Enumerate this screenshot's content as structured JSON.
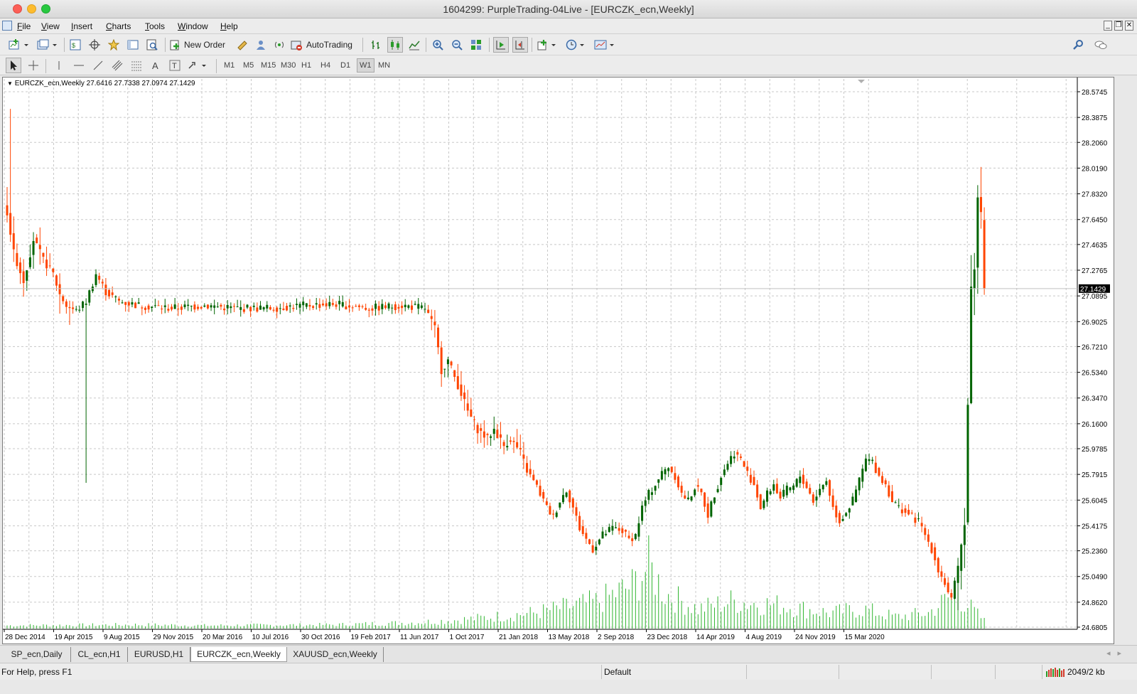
{
  "window": {
    "title": "1604299: PurpleTrading-04Live - [EURCZK_ecn,Weekly]"
  },
  "menu": [
    "File",
    "View",
    "Insert",
    "Charts",
    "Tools",
    "Window",
    "Help"
  ],
  "toolbar": {
    "new_order": "New Order",
    "auto_trading": "AutoTrading"
  },
  "timeframes": [
    "M1",
    "M5",
    "M15",
    "M30",
    "H1",
    "H4",
    "D1",
    "W1",
    "MN"
  ],
  "active_timeframe": "W1",
  "chart": {
    "legend": "EURCZK_ecn,Weekly  27.6416 27.7338 27.0974 27.1429",
    "current_price": "27.1429"
  },
  "chart_data": {
    "type": "candlestick",
    "symbol": "EURCZK_ecn",
    "period": "Weekly",
    "ohlc_last": {
      "open": 27.6416,
      "high": 27.7338,
      "low": 27.0974,
      "close": 27.1429
    },
    "y_ticks": [
      "28.5745",
      "28.3875",
      "28.2060",
      "28.0190",
      "27.8320",
      "27.6450",
      "27.4635",
      "27.2765",
      "27.0895",
      "26.9025",
      "26.7210",
      "26.5340",
      "26.3470",
      "26.1600",
      "25.9785",
      "25.7915",
      "25.6045",
      "25.4175",
      "25.2360",
      "25.0490",
      "24.8620",
      "24.6805"
    ],
    "ylim": [
      24.6805,
      28.5745
    ],
    "x_ticks": [
      "28 Dec 2014",
      "19 Apr 2015",
      "9 Aug 2015",
      "29 Nov 2015",
      "20 Mar 2016",
      "10 Jul 2016",
      "30 Oct 2016",
      "19 Feb 2017",
      "11 Jun 2017",
      "1 Oct 2017",
      "21 Jan 2018",
      "13 May 2018",
      "2 Sep 2018",
      "23 Dec 2018",
      "14 Apr 2019",
      "4 Aug 2019",
      "24 Nov 2019",
      "15 Mar 2020"
    ],
    "colors": {
      "bull": "#006400",
      "bear": "#ff4500",
      "grid": "#c8c8c8",
      "volume": "#2fb52f",
      "price_line": "#c0c0c0"
    },
    "grid": true,
    "close_path": [
      [
        0,
        27.7
      ],
      [
        2,
        27.4
      ],
      [
        5,
        27.2
      ],
      [
        8,
        27.5
      ],
      [
        11,
        27.35
      ],
      [
        14,
        27.25
      ],
      [
        16,
        27.1
      ],
      [
        18,
        27.02
      ],
      [
        21,
        26.98
      ],
      [
        24,
        27.05
      ],
      [
        27,
        27.25
      ],
      [
        30,
        27.12
      ],
      [
        34,
        27.05
      ],
      [
        40,
        27.02
      ],
      [
        50,
        27.0
      ],
      [
        60,
        27.02
      ],
      [
        70,
        27.0
      ],
      [
        80,
        27.0
      ],
      [
        90,
        27.02
      ],
      [
        100,
        27.03
      ],
      [
        110,
        27.0
      ],
      [
        120,
        27.02
      ],
      [
        127,
        27.0
      ],
      [
        130,
        26.85
      ],
      [
        132,
        26.55
      ],
      [
        134,
        26.62
      ],
      [
        136,
        26.5
      ],
      [
        138,
        26.38
      ],
      [
        140,
        26.25
      ],
      [
        143,
        26.12
      ],
      [
        146,
        26.05
      ],
      [
        148,
        26.12
      ],
      [
        151,
        26.0
      ],
      [
        153,
        26.05
      ],
      [
        156,
        25.95
      ],
      [
        158,
        25.82
      ],
      [
        161,
        25.7
      ],
      [
        164,
        25.55
      ],
      [
        166,
        25.48
      ],
      [
        168,
        25.6
      ],
      [
        170,
        25.68
      ],
      [
        172,
        25.55
      ],
      [
        174,
        25.4
      ],
      [
        176,
        25.32
      ],
      [
        178,
        25.25
      ],
      [
        181,
        25.35
      ],
      [
        184,
        25.4
      ],
      [
        187,
        25.38
      ],
      [
        189,
        25.32
      ],
      [
        191,
        25.35
      ],
      [
        193,
        25.55
      ],
      [
        195,
        25.65
      ],
      [
        197,
        25.72
      ],
      [
        199,
        25.8
      ],
      [
        201,
        25.85
      ],
      [
        203,
        25.78
      ],
      [
        205,
        25.65
      ],
      [
        207,
        25.6
      ],
      [
        209,
        25.7
      ],
      [
        211,
        25.65
      ],
      [
        213,
        25.5
      ],
      [
        215,
        25.65
      ],
      [
        217,
        25.78
      ],
      [
        219,
        25.88
      ],
      [
        221,
        25.95
      ],
      [
        223,
        25.9
      ],
      [
        225,
        25.8
      ],
      [
        227,
        25.72
      ],
      [
        229,
        25.55
      ],
      [
        231,
        25.65
      ],
      [
        233,
        25.72
      ],
      [
        235,
        25.62
      ],
      [
        237,
        25.68
      ],
      [
        239,
        25.7
      ],
      [
        241,
        25.78
      ],
      [
        243,
        25.7
      ],
      [
        245,
        25.6
      ],
      [
        247,
        25.68
      ],
      [
        249,
        25.75
      ],
      [
        251,
        25.55
      ],
      [
        253,
        25.45
      ],
      [
        255,
        25.52
      ],
      [
        257,
        25.6
      ],
      [
        259,
        25.75
      ],
      [
        261,
        25.9
      ],
      [
        263,
        25.88
      ],
      [
        265,
        25.78
      ],
      [
        267,
        25.72
      ],
      [
        269,
        25.6
      ],
      [
        271,
        25.55
      ],
      [
        273,
        25.52
      ],
      [
        275,
        25.48
      ],
      [
        277,
        25.45
      ],
      [
        279,
        25.35
      ],
      [
        281,
        25.25
      ],
      [
        283,
        25.1
      ],
      [
        285,
        25.0
      ],
      [
        287,
        24.88
      ],
      [
        289,
        25.1
      ],
      [
        291,
        25.45
      ],
      [
        292,
        26.3
      ],
      [
        293,
        27.15
      ],
      [
        294,
        27.3
      ],
      [
        295,
        27.8
      ],
      [
        296,
        27.7
      ],
      [
        297,
        27.14
      ]
    ],
    "volume_peaks": [
      [
        0,
        0.04
      ],
      [
        40,
        0.05
      ],
      [
        60,
        0.04
      ],
      [
        100,
        0.05
      ],
      [
        125,
        0.08
      ],
      [
        140,
        0.12
      ],
      [
        160,
        0.2
      ],
      [
        180,
        0.35
      ],
      [
        190,
        0.55
      ],
      [
        195,
        0.8
      ],
      [
        200,
        0.45
      ],
      [
        210,
        0.25
      ],
      [
        220,
        0.35
      ],
      [
        235,
        0.3
      ],
      [
        250,
        0.2
      ],
      [
        260,
        0.25
      ],
      [
        270,
        0.15
      ],
      [
        280,
        0.2
      ],
      [
        288,
        0.45
      ],
      [
        292,
        0.3
      ],
      [
        297,
        0.1
      ]
    ]
  },
  "tabs": [
    {
      "label": "SP_ecn,Daily"
    },
    {
      "label": "CL_ecn,H1"
    },
    {
      "label": "EURUSD,H1"
    },
    {
      "label": "EURCZK_ecn,Weekly"
    },
    {
      "label": "XAUUSD_ecn,Weekly"
    }
  ],
  "active_tab": "EURCZK_ecn,Weekly",
  "status": {
    "help": "For Help, press F1",
    "profile": "Default",
    "traffic": "2049/2 kb"
  }
}
